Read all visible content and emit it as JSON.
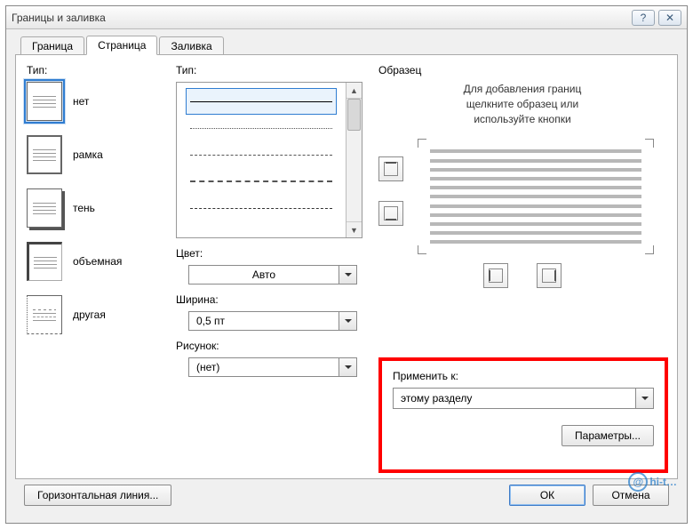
{
  "window": {
    "title": "Границы и заливка",
    "help_glyph": "?",
    "close_glyph": "✕"
  },
  "tabs": [
    {
      "label": "Граница"
    },
    {
      "label": "Страница"
    },
    {
      "label": "Заливка"
    }
  ],
  "left": {
    "section_label": "Тип:",
    "items": [
      {
        "label": "нет"
      },
      {
        "label": "рамка"
      },
      {
        "label": "тень"
      },
      {
        "label": "объемная"
      },
      {
        "label": "другая"
      }
    ]
  },
  "mid": {
    "type_label": "Тип:",
    "color": {
      "label": "Цвет:",
      "value": "Авто"
    },
    "width": {
      "label": "Ширина:",
      "value": "0,5 пт"
    },
    "art": {
      "label": "Рисунок:",
      "value": "(нет)"
    }
  },
  "right": {
    "section_label": "Образец",
    "hint_line1": "Для добавления границ",
    "hint_line2": "щелкните образец или",
    "hint_line3": "используйте кнопки",
    "apply_label": "Применить к:",
    "apply_value": "этому разделу",
    "params_button": "Параметры..."
  },
  "bottom": {
    "hline_button": "Горизонтальная линия...",
    "ok": "ОК",
    "cancel": "Отмена"
  },
  "watermark": {
    "at": "@",
    "text": "hi-t…"
  }
}
